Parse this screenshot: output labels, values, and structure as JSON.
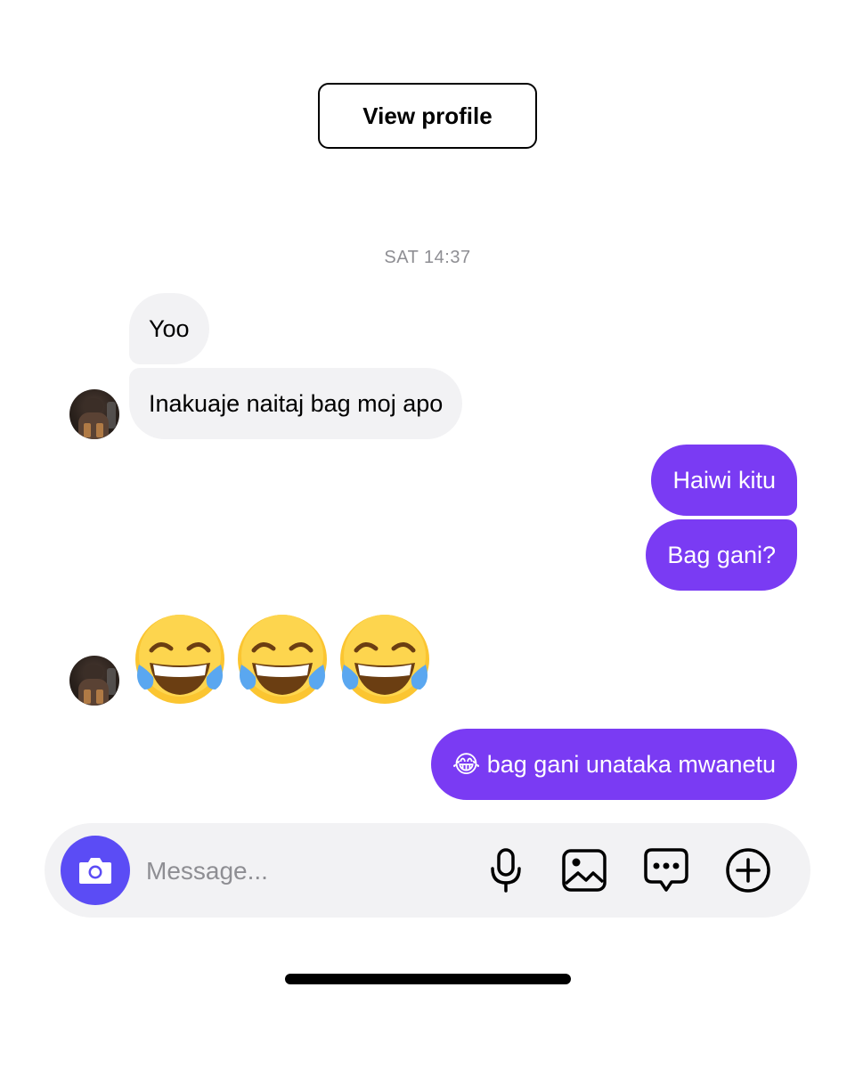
{
  "header": {
    "view_profile_label": "View profile"
  },
  "thread": {
    "timestamp": "SAT 14:37",
    "messages": [
      {
        "from": "them",
        "text": "Yoo"
      },
      {
        "from": "them",
        "text": "Inakuaje naitaj bag moj apo"
      },
      {
        "from": "me",
        "text": "Haiwi kitu"
      },
      {
        "from": "me",
        "text": "Bag gani?"
      },
      {
        "from": "them",
        "text": "😂😂😂"
      },
      {
        "from": "me",
        "text": "😂 bag gani unataka mwanetu"
      }
    ]
  },
  "composer": {
    "placeholder": "Message...",
    "icons": [
      "camera-icon",
      "microphone-icon",
      "gallery-icon",
      "sticker-icon",
      "plus-icon"
    ]
  },
  "colors": {
    "outgoing_bubble": "#7a3bf3",
    "incoming_bubble": "#f2f2f4",
    "camera_button": "#5b4cf5",
    "timestamp_text": "#8e8e93"
  }
}
